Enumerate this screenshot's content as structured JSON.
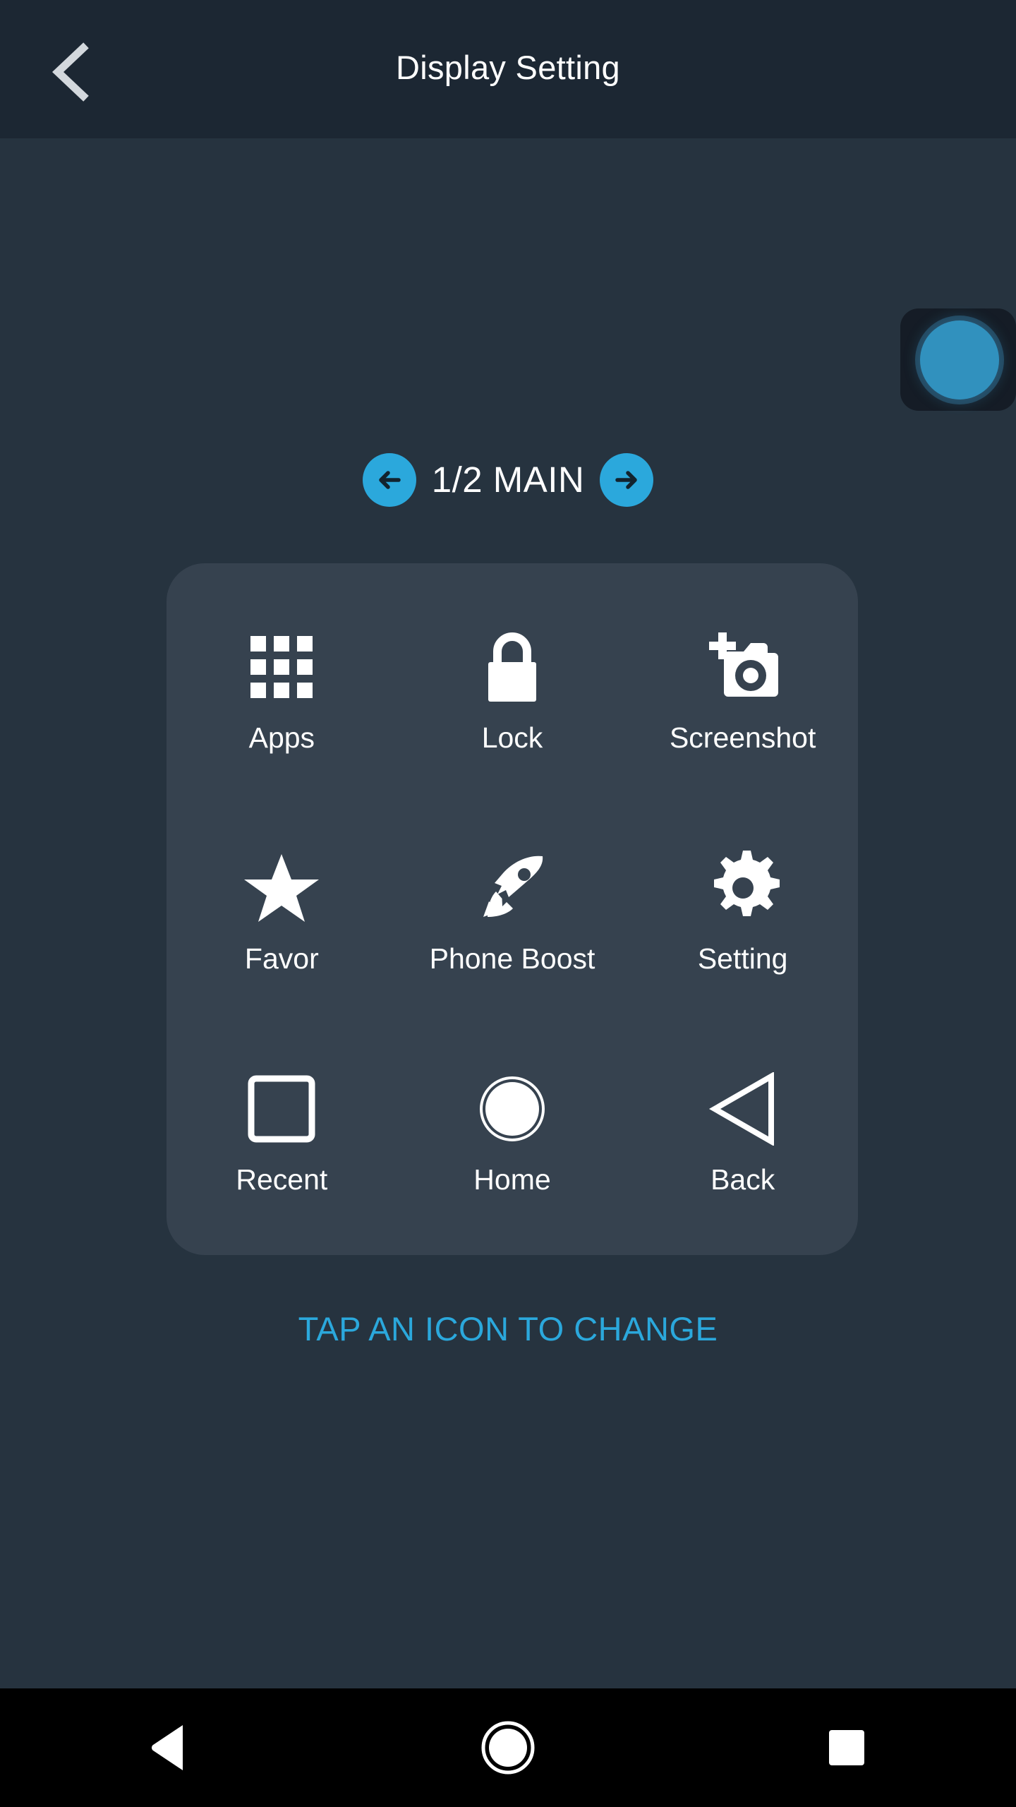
{
  "header": {
    "title": "Display Setting",
    "back_icon": "chevron-left-icon"
  },
  "floating_bubble": {
    "icon": "floating-ball-icon",
    "color": "#3295c4"
  },
  "pager": {
    "prev_icon": "arrow-left-icon",
    "next_icon": "arrow-right-icon",
    "label": "1/2 MAIN",
    "accent_color": "#2BA8DC"
  },
  "icon_grid": {
    "items": [
      {
        "label": "Apps",
        "icon": "apps-grid-icon"
      },
      {
        "label": "Lock",
        "icon": "lock-icon"
      },
      {
        "label": "Screenshot",
        "icon": "camera-plus-icon"
      },
      {
        "label": "Favor",
        "icon": "star-icon"
      },
      {
        "label": "Phone Boost",
        "icon": "rocket-icon"
      },
      {
        "label": "Setting",
        "icon": "gear-icon"
      },
      {
        "label": "Recent",
        "icon": "square-outline-icon"
      },
      {
        "label": "Home",
        "icon": "circle-icon"
      },
      {
        "label": "Back",
        "icon": "triangle-left-icon"
      }
    ],
    "card_color": "#36424f"
  },
  "hint": {
    "text": "TAP AN ICON TO CHANGE",
    "color": "#2BA8DC"
  },
  "system_navbar": {
    "back_icon": "nav-back-triangle-icon",
    "home_icon": "nav-home-circle-icon",
    "recents_icon": "nav-recents-square-icon"
  },
  "colors": {
    "header_background": "#1c2733",
    "page_background": "#26333f",
    "navbar_background": "#000000",
    "icon_white": "#ffffff"
  }
}
